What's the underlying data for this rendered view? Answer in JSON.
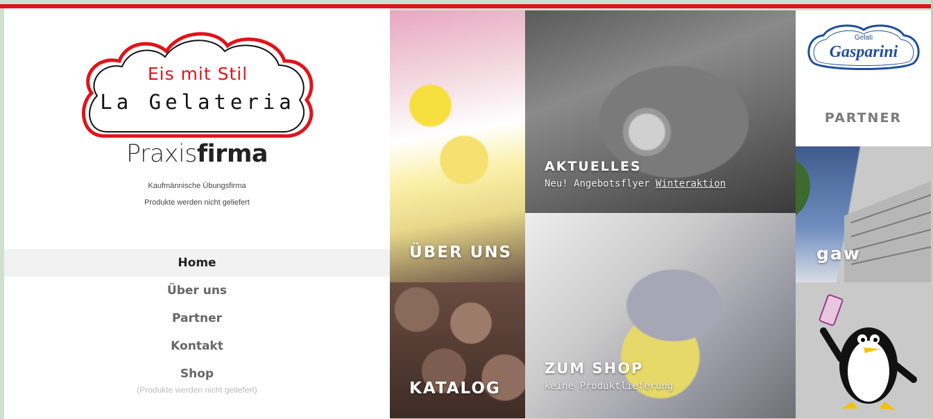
{
  "logo": {
    "slogan": "Eis mit Stil",
    "name": "La Gelateria"
  },
  "brand": {
    "light": "Praxis",
    "bold": "firma"
  },
  "taglines": {
    "line1": "Kaufmännische Übungsfirma",
    "line2": "Produkte werden nicht geliefert"
  },
  "nav": {
    "items": [
      {
        "label": "Home",
        "active": true
      },
      {
        "label": "Über uns"
      },
      {
        "label": "Partner"
      },
      {
        "label": "Kontakt"
      },
      {
        "label": "Shop"
      }
    ],
    "shop_note": "(Produkte werden nicht geliefert)"
  },
  "tiles": {
    "ueber_uns": {
      "label": "ÜBER UNS"
    },
    "katalog": {
      "label": "KATALOG"
    },
    "aktuelles": {
      "label": "AKTUELLES",
      "sub": "Neu! Angebotsflyer ",
      "sub_link": "Winteraktion"
    },
    "shop": {
      "label": "ZUM SHOP",
      "sub": "keine Produktlieferung"
    },
    "partner": {
      "logo_small": "Gelati",
      "logo_main": "Gasparini",
      "label": "PARTNER"
    },
    "gaw": {
      "label": "gaw"
    }
  },
  "colors": {
    "accent_red": "#e0141b",
    "partner_blue": "#1f4e9c"
  },
  "icons": {
    "penguin": "penguin-mascot-icon"
  }
}
